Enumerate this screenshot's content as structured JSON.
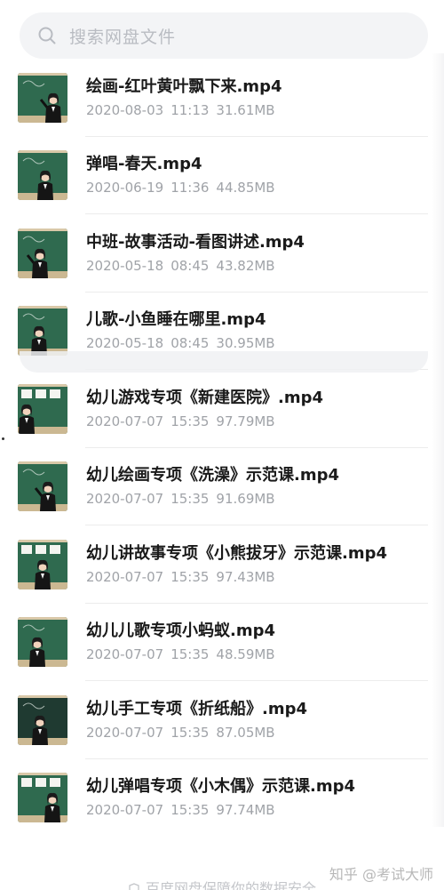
{
  "search": {
    "placeholder": "搜索网盘文件",
    "icon": "search-icon"
  },
  "files": [
    {
      "title": "绘画-红叶黄叶飘下来.mp4",
      "date": "2020-08-03",
      "time": "11:13",
      "size": "31.61MB"
    },
    {
      "title": "弹唱-春天.mp4",
      "date": "2020-06-19",
      "time": "11:36",
      "size": "44.85MB"
    },
    {
      "title": "中班-故事活动-看图讲述.mp4",
      "date": "2020-05-18",
      "time": "08:45",
      "size": "43.82MB"
    },
    {
      "title": "儿歌-小鱼睡在哪里.mp4",
      "date": "2020-05-18",
      "time": "08:45",
      "size": "30.95MB"
    },
    {
      "title": "幼儿游戏专项《新建医院》.mp4",
      "date": "2020-07-07",
      "time": "15:35",
      "size": "97.79MB"
    },
    {
      "title": "幼儿绘画专项《洗澡》示范课.mp4",
      "date": "2020-07-07",
      "time": "15:35",
      "size": "91.69MB"
    },
    {
      "title": "幼儿讲故事专项《小熊拔牙》示范课.mp4",
      "date": "2020-07-07",
      "time": "15:35",
      "size": "97.43MB"
    },
    {
      "title": "幼儿儿歌专项小蚂蚁.mp4",
      "date": "2020-07-07",
      "time": "15:35",
      "size": "48.59MB"
    },
    {
      "title": "幼儿手工专项《折纸船》.mp4",
      "date": "2020-07-07",
      "time": "15:35",
      "size": "87.05MB"
    },
    {
      "title": "幼儿弹唱专项《小木偶》示范课.mp4",
      "date": "2020-07-07",
      "time": "15:35",
      "size": "97.74MB"
    }
  ],
  "watermark": "知乎 @考试大师",
  "footer": "百度网盘保障你的数据安全",
  "colors": {
    "chalkboard": "#2f6a4f",
    "title_text": "#1a1a1a",
    "meta_text": "#a0a3a8",
    "search_bg": "#f3f4f6"
  }
}
